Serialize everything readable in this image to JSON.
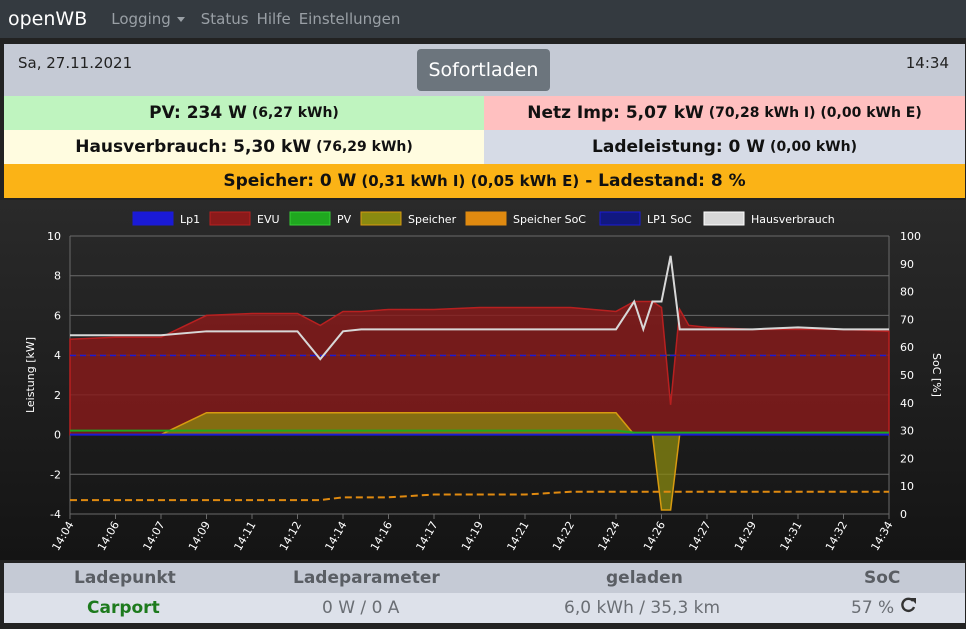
{
  "nav": {
    "brand": "openWB",
    "items": [
      {
        "label": "Logging",
        "dropdown": true
      },
      {
        "label": "Status"
      },
      {
        "label": "Hilfe"
      },
      {
        "label": "Einstellungen"
      }
    ]
  },
  "header": {
    "date": "Sa, 27.11.2021",
    "time": "14:34",
    "mode_button": "Sofortladen"
  },
  "summary": {
    "pv_main": "PV: 234 W",
    "pv_sub": "(6,27 kWh)",
    "netz_main": "Netz Imp: 5,07 kW",
    "netz_sub": "(70,28 kWh I) (0,00 kWh E)",
    "haus_main": "Hausverbrauch: 5,30 kW",
    "haus_sub": "(76,29 kWh)",
    "lade_main": "Ladeleistung: 0 W",
    "lade_sub": "(0,00 kWh)",
    "speicher_main": "Speicher: 0 W",
    "speicher_sub": "(0,31 kWh I) (0,05 kWh E)",
    "speicher_tail": "- Ladestand: 8 %"
  },
  "colors": {
    "pv_bg": "#bff4bf",
    "netz_bg": "#ffc0c0",
    "haus_bg": "#fffce0",
    "lade_bg": "#d6dbe6",
    "speicher_bg": "#fbb316",
    "lp1": "#1a1ad6",
    "evu": "#8b1a1a",
    "pv": "#1fa81f",
    "speicher": "#8a8a10",
    "speicher_soc": "#e08a10",
    "lp1_soc": "#1a1ad6",
    "hausverbrauch": "#d8d8d8"
  },
  "chart_data": {
    "type": "area",
    "legend": [
      "Lp1",
      "EVU",
      "PV",
      "Speicher",
      "Speicher SoC",
      "LP1 SoC",
      "Hausverbrauch"
    ],
    "legend_position": "top",
    "ylabel": "Leistung [kW]",
    "ylabel_right": "SoC [%]",
    "ylim": [
      -4,
      10
    ],
    "yticks": [
      "10",
      "8",
      "6",
      "4",
      "2",
      "0",
      "-2",
      "-4"
    ],
    "ylim_right": [
      0,
      100
    ],
    "yticks_right": [
      "100",
      "90",
      "80",
      "70",
      "60",
      "50",
      "40",
      "30",
      "20",
      "10",
      "0"
    ],
    "grid": true,
    "x_ticks": [
      "14:04",
      "14:06",
      "14:07",
      "14:09",
      "14:11",
      "14:12",
      "14:14",
      "14:16",
      "14:17",
      "14:19",
      "14:21",
      "14:22",
      "14:24",
      "14:26",
      "14:27",
      "14:29",
      "14:31",
      "14:32",
      "14:34"
    ],
    "x": [
      0,
      1,
      2,
      3,
      4,
      5,
      5.5,
      6,
      6.4,
      7,
      8,
      9,
      10,
      11,
      12,
      12.4,
      12.6,
      12.8,
      13,
      13.2,
      13.4,
      13.6,
      14,
      15,
      16,
      17,
      18
    ],
    "series": [
      {
        "name": "EVU",
        "values": [
          4.8,
          4.9,
          4.9,
          6.0,
          6.1,
          6.1,
          5.5,
          6.2,
          6.2,
          6.3,
          6.3,
          6.4,
          6.4,
          6.4,
          6.2,
          6.7,
          6.7,
          6.7,
          6.4,
          1.5,
          6.3,
          5.5,
          5.4,
          5.3,
          5.3,
          5.3,
          5.2
        ]
      },
      {
        "name": "Hausverbrauch",
        "values": [
          5.0,
          5.0,
          5.0,
          5.2,
          5.2,
          5.2,
          3.8,
          5.2,
          5.3,
          5.3,
          5.3,
          5.3,
          5.3,
          5.3,
          5.3,
          6.7,
          5.3,
          6.7,
          6.7,
          9.0,
          5.3,
          5.3,
          5.3,
          5.3,
          5.4,
          5.3,
          5.3
        ]
      },
      {
        "name": "Speicher",
        "values": [
          0,
          0,
          0,
          1.1,
          1.1,
          1.1,
          1.1,
          1.1,
          1.1,
          1.1,
          1.1,
          1.1,
          1.1,
          1.1,
          1.1,
          0,
          0,
          0,
          -3.8,
          -3.8,
          0,
          0,
          0,
          0,
          0,
          0,
          0
        ]
      },
      {
        "name": "PV",
        "values": [
          0.2,
          0.2,
          0.2,
          0.2,
          0.2,
          0.2,
          0.2,
          0.2,
          0.2,
          0.2,
          0.2,
          0.2,
          0.2,
          0.2,
          0.2,
          0.1,
          0.1,
          0.1,
          0.1,
          0.1,
          0.1,
          0.1,
          0.1,
          0.1,
          0.1,
          0.1,
          0.1
        ]
      },
      {
        "name": "Lp1",
        "values": [
          0,
          0,
          0,
          0,
          0,
          0,
          0,
          0,
          0,
          0,
          0,
          0,
          0,
          0,
          0,
          0,
          0,
          0,
          0,
          0,
          0,
          0,
          0,
          0,
          0,
          0,
          0
        ]
      },
      {
        "name": "Speicher SoC",
        "axis": "right",
        "values": [
          5,
          5,
          5,
          5,
          5,
          5,
          5,
          6,
          6,
          6,
          7,
          7,
          7,
          8,
          8,
          8,
          8,
          8,
          8,
          8,
          8,
          8,
          8,
          8,
          8,
          8,
          8
        ]
      },
      {
        "name": "LP1 SoC",
        "axis": "right",
        "values": [
          57,
          57,
          57,
          57,
          57,
          57,
          57,
          57,
          57,
          57,
          57,
          57,
          57,
          57,
          57,
          57,
          57,
          57,
          57,
          57,
          57,
          57,
          57,
          57,
          57,
          57,
          57
        ]
      }
    ]
  },
  "table": {
    "headers": [
      "Ladepunkt",
      "Ladeparameter",
      "geladen",
      "SoC"
    ],
    "row": {
      "name": "Carport",
      "param": "0 W / 0 A",
      "geladen": "6,0 kWh / 35,3 km",
      "soc": "57 %"
    }
  }
}
